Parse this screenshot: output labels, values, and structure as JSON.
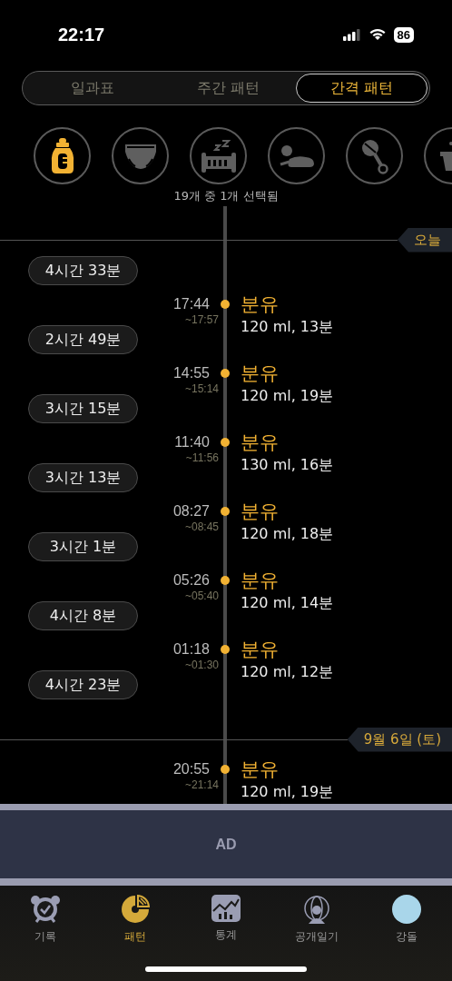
{
  "status_bar": {
    "time": "22:17",
    "battery": "86"
  },
  "segments": [
    {
      "label": "일과표",
      "selected": false
    },
    {
      "label": "주간 패턴",
      "selected": false
    },
    {
      "label": "간격 패턴",
      "selected": true
    }
  ],
  "categories": [
    {
      "kind": "bottle",
      "selected": true
    },
    {
      "kind": "diaper",
      "selected": false
    },
    {
      "kind": "crib",
      "selected": false
    },
    {
      "kind": "tummy",
      "selected": false
    },
    {
      "kind": "rattle",
      "selected": false
    },
    {
      "kind": "pot",
      "selected": false
    }
  ],
  "selection_caption": "19개 중 1개 선택됨",
  "days": [
    {
      "label": "오늘",
      "items": [
        {
          "kind": "interval",
          "text": "4시간 33분"
        },
        {
          "kind": "entry",
          "time": "17:44",
          "end": "~17:57",
          "title": "분유",
          "detail": "120 ml, 13분"
        },
        {
          "kind": "interval",
          "text": "2시간 49분"
        },
        {
          "kind": "entry",
          "time": "14:55",
          "end": "~15:14",
          "title": "분유",
          "detail": "120 ml, 19분"
        },
        {
          "kind": "interval",
          "text": "3시간 15분"
        },
        {
          "kind": "entry",
          "time": "11:40",
          "end": "~11:56",
          "title": "분유",
          "detail": "130 ml, 16분"
        },
        {
          "kind": "interval",
          "text": "3시간 13분"
        },
        {
          "kind": "entry",
          "time": "08:27",
          "end": "~08:45",
          "title": "분유",
          "detail": "120 ml, 18분"
        },
        {
          "kind": "interval",
          "text": "3시간 1분"
        },
        {
          "kind": "entry",
          "time": "05:26",
          "end": "~05:40",
          "title": "분유",
          "detail": "120 ml, 14분"
        },
        {
          "kind": "interval",
          "text": "4시간 8분"
        },
        {
          "kind": "entry",
          "time": "01:18",
          "end": "~01:30",
          "title": "분유",
          "detail": "120 ml, 12분"
        },
        {
          "kind": "interval",
          "text": "4시간 23분"
        }
      ]
    },
    {
      "label": "9월 6일 (토)",
      "items": [
        {
          "kind": "entry",
          "time": "20:55",
          "end": "~21:14",
          "title": "분유",
          "detail": "120 ml, 19분"
        }
      ]
    }
  ],
  "ad": {
    "label": "AD"
  },
  "tab_bar": [
    {
      "kind": "alarm",
      "label": "기록",
      "selected": false
    },
    {
      "kind": "pattern",
      "label": "패턴",
      "selected": true
    },
    {
      "kind": "stats",
      "label": "통계",
      "selected": false
    },
    {
      "kind": "globe",
      "label": "공개일기",
      "selected": false
    },
    {
      "kind": "face",
      "label": "강돌",
      "selected": false
    }
  ]
}
